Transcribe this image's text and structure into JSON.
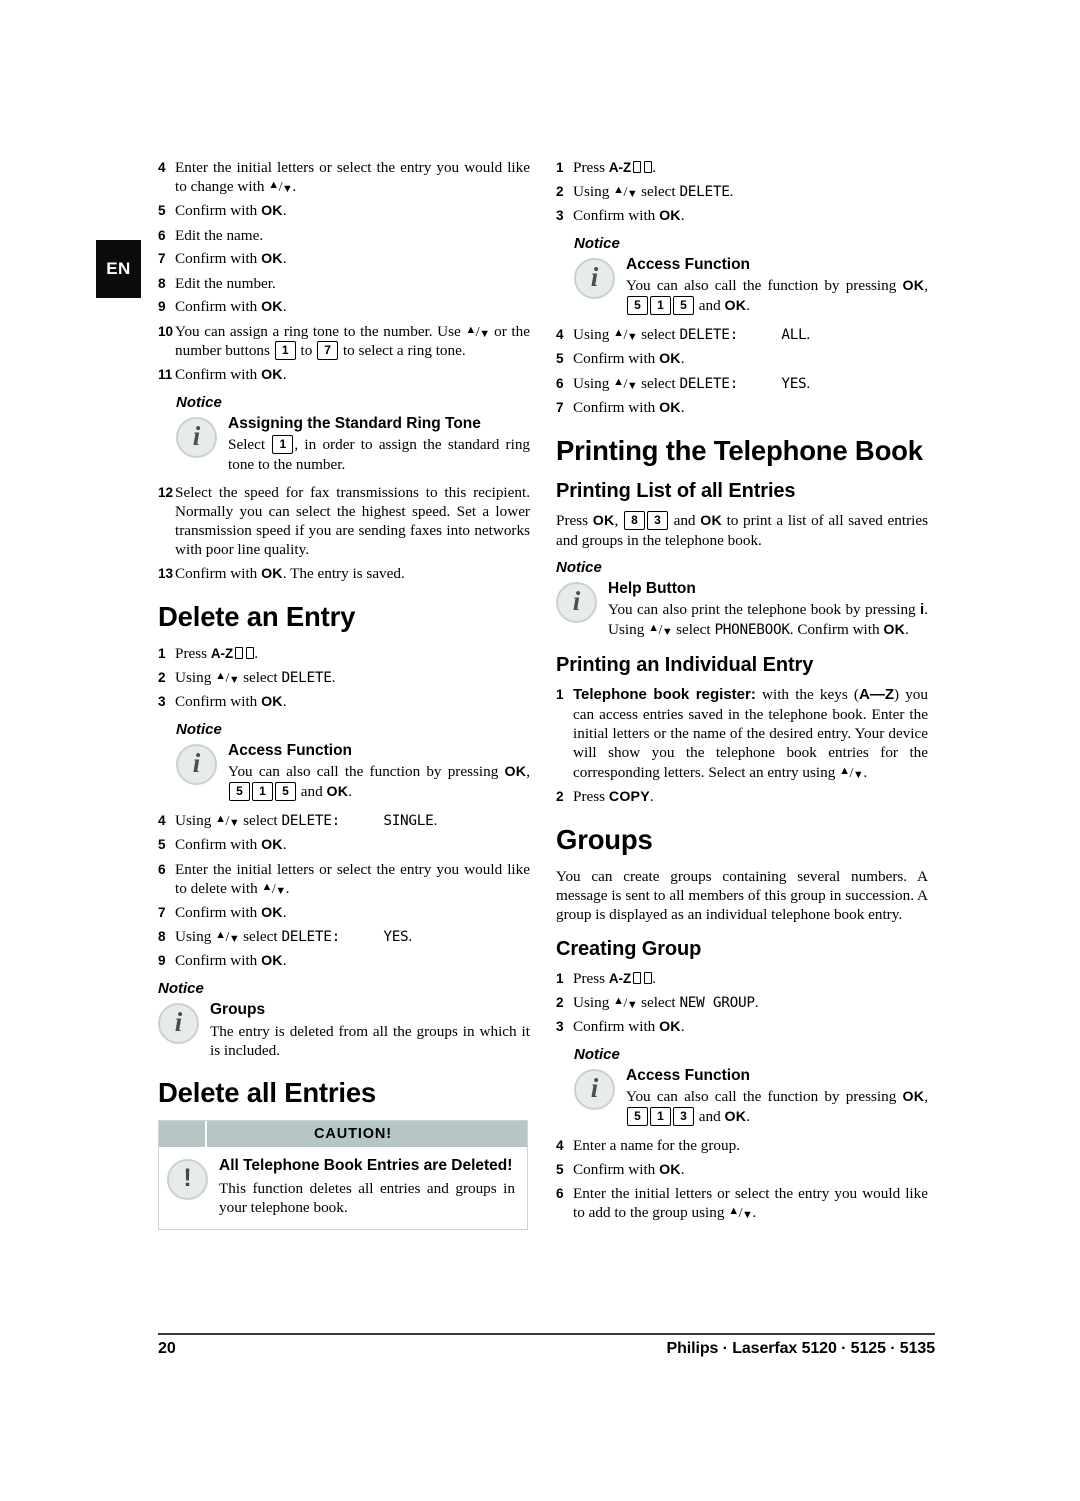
{
  "page": {
    "language_tab": "EN",
    "page_number": "20",
    "footer_brand": "Philips · Laserfax 5120 · 5125 · 5135"
  },
  "labels": {
    "notice": "Notice",
    "caution": "CAUTION!",
    "ok": "OK",
    "copy": "COPY",
    "az": "A-Z",
    "a_to_z_keys": "A—Z",
    "info_glyph": "i",
    "caution_glyph": "!"
  },
  "colors": {
    "caution_header_bg": "#b6c5c5",
    "caution_border": "#c9d5d5",
    "icon_fill": "#e7eceb",
    "icon_ring": "#c7d2d1",
    "lang_tab_bg": "#0c0c0c"
  },
  "left_column": {
    "steps_change_entry": [
      {
        "num": "4",
        "text_parts": [
          "Enter the initial letters or select the entry you would like to change with ",
          "updown",
          "."
        ]
      },
      {
        "num": "5",
        "text_parts": [
          "Confirm with ",
          "ok",
          "."
        ]
      },
      {
        "num": "6",
        "text_parts": [
          "Edit the name."
        ]
      },
      {
        "num": "7",
        "text_parts": [
          "Confirm with ",
          "ok",
          "."
        ]
      },
      {
        "num": "8",
        "text_parts": [
          "Edit the number."
        ]
      },
      {
        "num": "9",
        "text_parts": [
          "Confirm with ",
          "ok",
          "."
        ]
      },
      {
        "num": "10",
        "text_parts": [
          "You can assign a ring tone to the number. Use ",
          "updown",
          " or the number buttons ",
          "key:1",
          " to ",
          "key:7",
          " to select a ring tone."
        ]
      },
      {
        "num": "11",
        "text_parts": [
          "Confirm with ",
          "ok",
          "."
        ]
      }
    ],
    "notice_ring_tone": {
      "label": "Notice",
      "heading": "Assigning the Standard Ring Tone",
      "text_before_key": "Select ",
      "key": "1",
      "text_after_key": ", in order to assign the standard ring tone to the number."
    },
    "steps_change_entry_cont": [
      {
        "num": "12",
        "text_parts": [
          "Select the speed for fax transmissions to this recipient. Normally you can select the highest speed. Set a lower transmission speed if you are sending faxes into networks with poor line quality."
        ]
      },
      {
        "num": "13",
        "text_parts": [
          "Confirm with ",
          "ok",
          ". The entry is saved."
        ]
      }
    ],
    "heading_delete_entry": "Delete an Entry",
    "steps_delete_entry_a": [
      {
        "num": "1",
        "text_parts": [
          "Press ",
          "az",
          "."
        ]
      },
      {
        "num": "2",
        "text_parts": [
          "Using ",
          "updown",
          " select ",
          "lcd:DELETE",
          "."
        ]
      },
      {
        "num": "3",
        "text_parts": [
          "Confirm with ",
          "ok",
          "."
        ]
      }
    ],
    "notice_access_function_1": {
      "label": "Notice",
      "heading": "Access Function",
      "text": "You can also call the function by pressing ",
      "ok": "OK",
      "keys": [
        "5",
        "1",
        "5"
      ],
      "tail": " and ",
      "ok2": "OK",
      "end": "."
    },
    "steps_delete_entry_b": [
      {
        "num": "4",
        "text_parts": [
          "Using ",
          "updown",
          " select ",
          "lcd2:DELETE:|SINGLE",
          "."
        ]
      },
      {
        "num": "5",
        "text_parts": [
          "Confirm with ",
          "ok",
          "."
        ]
      },
      {
        "num": "6",
        "text_parts": [
          "Enter the initial letters or select the entry you would like to delete with ",
          "updown",
          "."
        ]
      },
      {
        "num": "7",
        "text_parts": [
          "Confirm with ",
          "ok",
          "."
        ]
      },
      {
        "num": "8",
        "text_parts": [
          "Using ",
          "updown",
          " select ",
          "lcd2:DELETE:|YES",
          "."
        ]
      },
      {
        "num": "9",
        "text_parts": [
          "Confirm with ",
          "ok",
          "."
        ]
      }
    ],
    "notice_groups": {
      "label": "Notice",
      "heading": "Groups",
      "text": "The entry is deleted from all the groups in which it is included."
    },
    "heading_delete_all": "Delete all Entries",
    "caution_box": {
      "title": "CAUTION!",
      "heading": "All Telephone Book Entries are Deleted!",
      "text": "This function deletes all entries and groups in your telephone book."
    }
  },
  "right_column": {
    "steps_delete_all_a": [
      {
        "num": "1",
        "text_parts": [
          "Press ",
          "az",
          "."
        ]
      },
      {
        "num": "2",
        "text_parts": [
          "Using ",
          "updown",
          " select ",
          "lcd:DELETE",
          "."
        ]
      },
      {
        "num": "3",
        "text_parts": [
          "Confirm with ",
          "ok",
          "."
        ]
      }
    ],
    "notice_access_function_2": {
      "label": "Notice",
      "heading": "Access Function",
      "text": "You can also call the function by pressing ",
      "ok": "OK",
      "keys": [
        "5",
        "1",
        "5"
      ],
      "tail": " and ",
      "ok2": "OK",
      "end": "."
    },
    "steps_delete_all_b": [
      {
        "num": "4",
        "text_parts": [
          "Using ",
          "updown",
          " select ",
          "lcd2:DELETE:|ALL",
          "."
        ]
      },
      {
        "num": "5",
        "text_parts": [
          "Confirm with ",
          "ok",
          "."
        ]
      },
      {
        "num": "6",
        "text_parts": [
          "Using ",
          "updown",
          " select ",
          "lcd2:DELETE:|YES",
          "."
        ]
      },
      {
        "num": "7",
        "text_parts": [
          "Confirm with ",
          "ok",
          "."
        ]
      }
    ],
    "heading_printing_book": "Printing the Telephone Book",
    "heading_printing_list": "Printing List of all Entries",
    "printing_list_text": {
      "before": "Press ",
      "ok": "OK",
      "comma": ", ",
      "keys": [
        "8",
        "3"
      ],
      "mid": " and ",
      "ok2": "OK",
      "after": " to print a list of all saved entries and groups in the telephone book."
    },
    "notice_help_button": {
      "label": "Notice",
      "heading": "Help Button",
      "p1": "You can also print the telephone book by pressing ",
      "i": "i",
      "p2": ". Using ",
      "p3": " select ",
      "lcd": "PHONEBOOK",
      "p4": ". Confirm with ",
      "ok": "OK",
      "p5": "."
    },
    "heading_printing_individual": "Printing an Individual Entry",
    "steps_printing_individual": [
      {
        "num": "1",
        "bold_lead": "Telephone book register:",
        "text": " with the keys (",
        "keys_label": "A—Z",
        "text2": ") you can access entries saved in the telephone book. Enter the initial letters or the name of the desired entry. Your device will show you the telephone book entries for the corresponding letters. Select an entry using ",
        "tail": "."
      },
      {
        "num": "2",
        "text_parts": [
          "Press ",
          "copy",
          "."
        ]
      }
    ],
    "heading_groups": "Groups",
    "groups_text": "You can create groups containing several numbers. A message is sent to all members of this group in succession. A group is displayed as an individual telephone book entry.",
    "heading_creating_group": "Creating Group",
    "steps_creating_group_a": [
      {
        "num": "1",
        "text_parts": [
          "Press ",
          "az",
          "."
        ]
      },
      {
        "num": "2",
        "text_parts": [
          "Using ",
          "updown",
          " select ",
          "lcd:NEW GROUP",
          "."
        ]
      },
      {
        "num": "3",
        "text_parts": [
          "Confirm with ",
          "ok",
          "."
        ]
      }
    ],
    "notice_access_function_3": {
      "label": "Notice",
      "heading": "Access Function",
      "text": "You can also call the function by pressing ",
      "ok": "OK",
      "keys": [
        "5",
        "1",
        "3"
      ],
      "tail": " and ",
      "ok2": "OK",
      "end": "."
    },
    "steps_creating_group_b": [
      {
        "num": "4",
        "text_parts": [
          "Enter a name for the group."
        ]
      },
      {
        "num": "5",
        "text_parts": [
          "Confirm with ",
          "ok",
          "."
        ]
      },
      {
        "num": "6",
        "text_parts": [
          "Enter the initial letters or select the entry you would like to add to the group using ",
          "updown",
          "."
        ]
      }
    ]
  }
}
